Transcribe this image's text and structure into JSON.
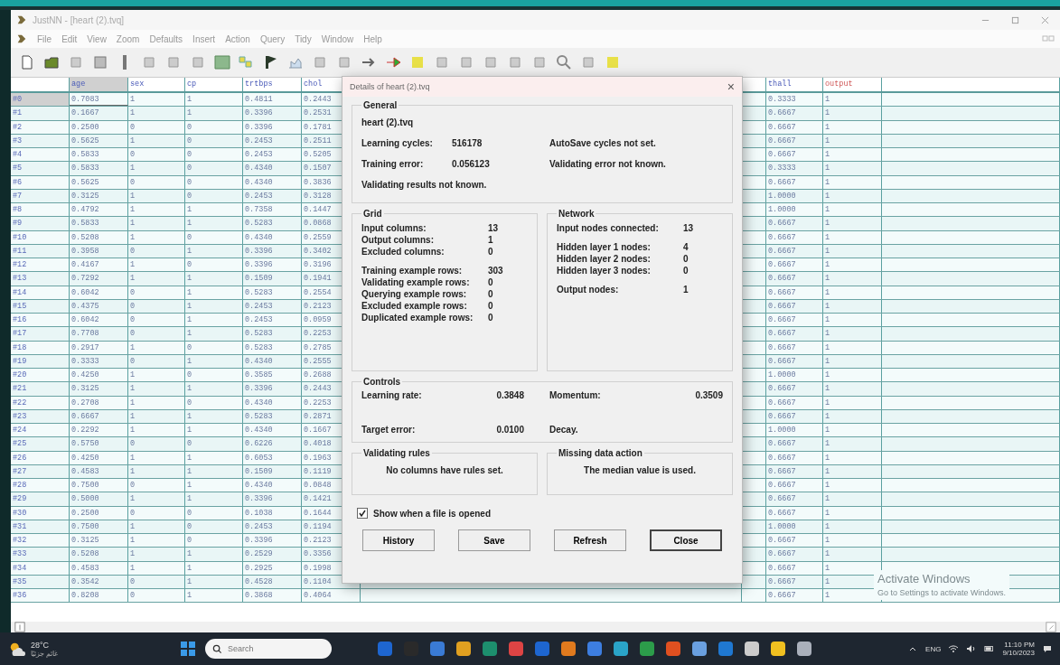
{
  "window": {
    "title": "JustNN - [heart (2).tvq]"
  },
  "menu": [
    "File",
    "Edit",
    "View",
    "Zoom",
    "Defaults",
    "Insert",
    "Action",
    "Query",
    "Tidy",
    "Window",
    "Help"
  ],
  "table": {
    "columns": [
      {
        "label": "age",
        "selected": true
      },
      {
        "label": "sex",
        "selected": false
      },
      {
        "label": "cp",
        "selected": false
      },
      {
        "label": "trtbps",
        "selected": false
      },
      {
        "label": "chol",
        "selected": false
      },
      {
        "label": "thall",
        "selected": false
      },
      {
        "label": "output",
        "selected": false,
        "kind": "output"
      }
    ],
    "rows": [
      {
        "label": "#0",
        "selected": true,
        "cells": [
          "0.7083",
          "1",
          "1",
          "0.4811",
          "0.2443",
          "0.3333",
          "1"
        ]
      },
      {
        "label": "#1",
        "selected": false,
        "cells": [
          "0.1667",
          "1",
          "1",
          "0.3396",
          "0.2531",
          "0.6667",
          "1"
        ]
      },
      {
        "label": "#2",
        "selected": false,
        "cells": [
          "0.2500",
          "0",
          "0",
          "0.3396",
          "0.1781",
          "0.6667",
          "1"
        ]
      },
      {
        "label": "#3",
        "selected": false,
        "cells": [
          "0.5625",
          "1",
          "0",
          "0.2453",
          "0.2511",
          "0.6667",
          "1"
        ]
      },
      {
        "label": "#4",
        "selected": false,
        "cells": [
          "0.5833",
          "0",
          "0",
          "0.2453",
          "0.5205",
          "0.6667",
          "1"
        ]
      },
      {
        "label": "#5",
        "selected": false,
        "cells": [
          "0.5833",
          "1",
          "0",
          "0.4340",
          "0.1507",
          "0.3333",
          "1"
        ]
      },
      {
        "label": "#6",
        "selected": false,
        "cells": [
          "0.5625",
          "0",
          "0",
          "0.4340",
          "0.3836",
          "0.6667",
          "1"
        ]
      },
      {
        "label": "#7",
        "selected": false,
        "cells": [
          "0.3125",
          "1",
          "0",
          "0.2453",
          "0.3128",
          "1.0000",
          "1"
        ]
      },
      {
        "label": "#8",
        "selected": false,
        "cells": [
          "0.4792",
          "1",
          "1",
          "0.7358",
          "0.1447",
          "1.0000",
          "1"
        ]
      },
      {
        "label": "#9",
        "selected": false,
        "cells": [
          "0.5833",
          "1",
          "1",
          "0.5283",
          "0.0868",
          "0.6667",
          "1"
        ]
      },
      {
        "label": "#10",
        "selected": false,
        "cells": [
          "0.5208",
          "1",
          "0",
          "0.4340",
          "0.2559",
          "0.6667",
          "1"
        ]
      },
      {
        "label": "#11",
        "selected": false,
        "cells": [
          "0.3958",
          "0",
          "1",
          "0.3396",
          "0.3402",
          "0.6667",
          "1"
        ]
      },
      {
        "label": "#12",
        "selected": false,
        "cells": [
          "0.4167",
          "1",
          "0",
          "0.3396",
          "0.3196",
          "0.6667",
          "1"
        ]
      },
      {
        "label": "#13",
        "selected": false,
        "cells": [
          "0.7292",
          "1",
          "1",
          "0.1509",
          "0.1941",
          "0.6667",
          "1"
        ]
      },
      {
        "label": "#14",
        "selected": false,
        "cells": [
          "0.6042",
          "0",
          "1",
          "0.5283",
          "0.2554",
          "0.6667",
          "1"
        ]
      },
      {
        "label": "#15",
        "selected": false,
        "cells": [
          "0.4375",
          "0",
          "1",
          "0.2453",
          "0.2123",
          "0.6667",
          "1"
        ]
      },
      {
        "label": "#16",
        "selected": false,
        "cells": [
          "0.6042",
          "0",
          "1",
          "0.2453",
          "0.0959",
          "0.6667",
          "1"
        ]
      },
      {
        "label": "#17",
        "selected": false,
        "cells": [
          "0.7708",
          "0",
          "1",
          "0.5283",
          "0.2253",
          "0.6667",
          "1"
        ]
      },
      {
        "label": "#18",
        "selected": false,
        "cells": [
          "0.2917",
          "1",
          "0",
          "0.5283",
          "0.2785",
          "0.6667",
          "1"
        ]
      },
      {
        "label": "#19",
        "selected": false,
        "cells": [
          "0.3333",
          "0",
          "1",
          "0.4340",
          "0.2555",
          "0.6667",
          "1"
        ]
      },
      {
        "label": "#20",
        "selected": false,
        "cells": [
          "0.4250",
          "1",
          "0",
          "0.3585",
          "0.2688",
          "1.0000",
          "1"
        ]
      },
      {
        "label": "#21",
        "selected": false,
        "cells": [
          "0.3125",
          "1",
          "1",
          "0.3396",
          "0.2443",
          "0.6667",
          "1"
        ]
      },
      {
        "label": "#22",
        "selected": false,
        "cells": [
          "0.2708",
          "1",
          "0",
          "0.4340",
          "0.2253",
          "0.6667",
          "1"
        ]
      },
      {
        "label": "#23",
        "selected": false,
        "cells": [
          "0.6667",
          "1",
          "1",
          "0.5283",
          "0.2871",
          "0.6667",
          "1"
        ]
      },
      {
        "label": "#24",
        "selected": false,
        "cells": [
          "0.2292",
          "1",
          "1",
          "0.4340",
          "0.1667",
          "1.0000",
          "1"
        ]
      },
      {
        "label": "#25",
        "selected": false,
        "cells": [
          "0.5750",
          "0",
          "0",
          "0.6226",
          "0.4018",
          "0.6667",
          "1"
        ]
      },
      {
        "label": "#26",
        "selected": false,
        "cells": [
          "0.4250",
          "1",
          "1",
          "0.6053",
          "0.1963",
          "0.6667",
          "1"
        ]
      },
      {
        "label": "#27",
        "selected": false,
        "cells": [
          "0.4583",
          "1",
          "1",
          "0.1509",
          "0.1119",
          "0.6667",
          "1"
        ]
      },
      {
        "label": "#28",
        "selected": false,
        "cells": [
          "0.7500",
          "0",
          "1",
          "0.4340",
          "0.0848",
          "0.6667",
          "1"
        ]
      },
      {
        "label": "#29",
        "selected": false,
        "cells": [
          "0.5000",
          "1",
          "1",
          "0.3396",
          "0.1421",
          "0.6667",
          "1"
        ]
      },
      {
        "label": "#30",
        "selected": false,
        "cells": [
          "0.2500",
          "0",
          "0",
          "0.1038",
          "0.1644",
          "0.6667",
          "1"
        ]
      },
      {
        "label": "#31",
        "selected": false,
        "cells": [
          "0.7500",
          "1",
          "0",
          "0.2453",
          "0.1194",
          "1.0000",
          "1"
        ]
      },
      {
        "label": "#32",
        "selected": false,
        "cells": [
          "0.3125",
          "1",
          "0",
          "0.3396",
          "0.2123",
          "0.6667",
          "1"
        ]
      },
      {
        "label": "#33",
        "selected": false,
        "cells": [
          "0.5208",
          "1",
          "1",
          "0.2529",
          "0.3356",
          "0.6667",
          "1"
        ]
      },
      {
        "label": "#34",
        "selected": false,
        "cells": [
          "0.4583",
          "1",
          "1",
          "0.2925",
          "0.1998",
          "0.6667",
          "1"
        ]
      },
      {
        "label": "#35",
        "selected": false,
        "cells": [
          "0.3542",
          "0",
          "1",
          "0.4528",
          "0.1104",
          "0.6667",
          "1"
        ]
      },
      {
        "label": "#36",
        "selected": false,
        "cells": [
          "0.8208",
          "0",
          "1",
          "0.3868",
          "0.4064",
          "0.6667",
          "1"
        ]
      }
    ]
  },
  "dialog": {
    "title": "Details of heart (2).tvq",
    "close": "×",
    "general": {
      "title": "General",
      "file": "heart (2).tvq",
      "lines": [
        {
          "label": "Learning cycles:",
          "value": "516178",
          "note": "AutoSave cycles not set."
        },
        {
          "label": "Training error:",
          "value": "0.056123",
          "note": "Validating error not known."
        }
      ],
      "footer": "Validating results not known."
    },
    "grid": {
      "title": "Grid",
      "groups": [
        [
          {
            "label": "Input columns:",
            "value": "13"
          },
          {
            "label": "Output columns:",
            "value": "1"
          },
          {
            "label": "Excluded columns:",
            "value": "0"
          }
        ],
        [
          {
            "label": "Training example rows:",
            "value": "303"
          },
          {
            "label": "Validating example rows:",
            "value": "0"
          },
          {
            "label": "Querying example rows:",
            "value": "0"
          },
          {
            "label": "Excluded example rows:",
            "value": "0"
          },
          {
            "label": "Duplicated example rows:",
            "value": "0"
          }
        ]
      ]
    },
    "network": {
      "title": "Network",
      "groups": [
        [
          {
            "label": "Input nodes connected:",
            "value": "13"
          }
        ],
        [
          {
            "label": "Hidden layer 1 nodes:",
            "value": "4"
          },
          {
            "label": "Hidden layer 2 nodes:",
            "value": "0"
          },
          {
            "label": "Hidden layer 3 nodes:",
            "value": "0"
          }
        ],
        [
          {
            "label": "Output nodes:",
            "value": "1"
          }
        ]
      ]
    },
    "controls": {
      "title": "Controls",
      "rows": [
        [
          {
            "label": "Learning rate:",
            "value": "0.3848"
          },
          {
            "label": "Momentum:",
            "value": "0.3509"
          }
        ],
        [
          {
            "label": "Target error:",
            "value": "0.0100"
          },
          {
            "label": "Decay."
          }
        ]
      ]
    },
    "validating_rules": {
      "title": "Validating rules",
      "text": "No columns have rules set."
    },
    "missing_data": {
      "title": "Missing data action",
      "text": "The median value is used."
    },
    "show_on_open": {
      "label": "Show when a file is opened",
      "checked": true
    },
    "buttons": [
      {
        "label": "History",
        "default": false
      },
      {
        "label": "Save",
        "default": false
      },
      {
        "label": "Refresh",
        "default": false
      },
      {
        "label": "Close",
        "default": true
      }
    ]
  },
  "watermark": {
    "title": "Activate Windows",
    "text": "Go to Settings to activate Windows."
  },
  "taskbar": {
    "weather": {
      "temp": "28°C",
      "text": "غائم جزئيًا"
    },
    "search": {
      "placeholder": "Search"
    },
    "language": "ENG",
    "time": "11:10 PM",
    "date": "9/10/2023"
  }
}
